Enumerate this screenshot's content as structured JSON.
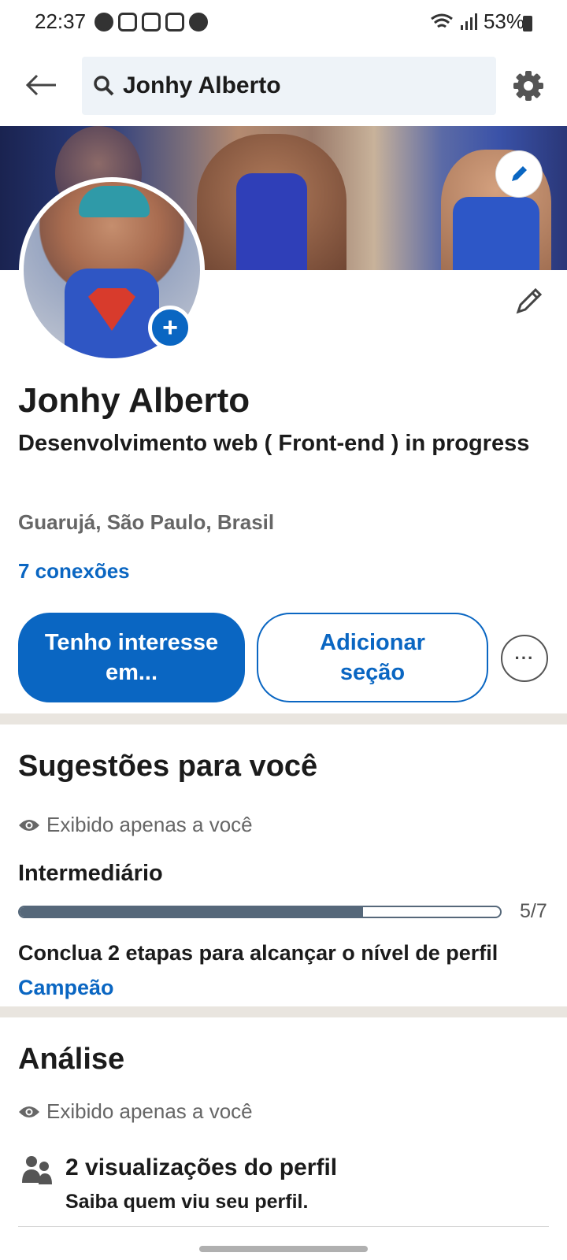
{
  "status_bar": {
    "time": "22:37",
    "battery": "53%"
  },
  "search": {
    "query": "Jonhy Alberto"
  },
  "profile": {
    "name": "Jonhy Alberto",
    "headline": "Desenvolvimento web ( Front-end ) in progress",
    "location": "Guarujá, São Paulo, Brasil",
    "connections": "7 conexões"
  },
  "actions": {
    "primary_label": "Tenho interesse em...",
    "secondary_label": "Adicionar seção",
    "more_label": "···"
  },
  "suggestions": {
    "title": "Sugestões para você",
    "private_note": "Exibido apenas a você",
    "level": "Intermediário",
    "progress_count": "5/7",
    "progress_fraction": 0.714,
    "steps_text": "Conclua 2 etapas para alcançar o nível de perfil",
    "steps_link": "Campeão"
  },
  "analytics": {
    "title": "Análise",
    "private_note": "Exibido apenas a você",
    "item_title": "2 visualizações do perfil",
    "item_subtitle": "Saiba quem viu seu perfil."
  },
  "colors": {
    "accent": "#0a66c2",
    "progress": "#56687a",
    "divider": "#e9e5df"
  }
}
